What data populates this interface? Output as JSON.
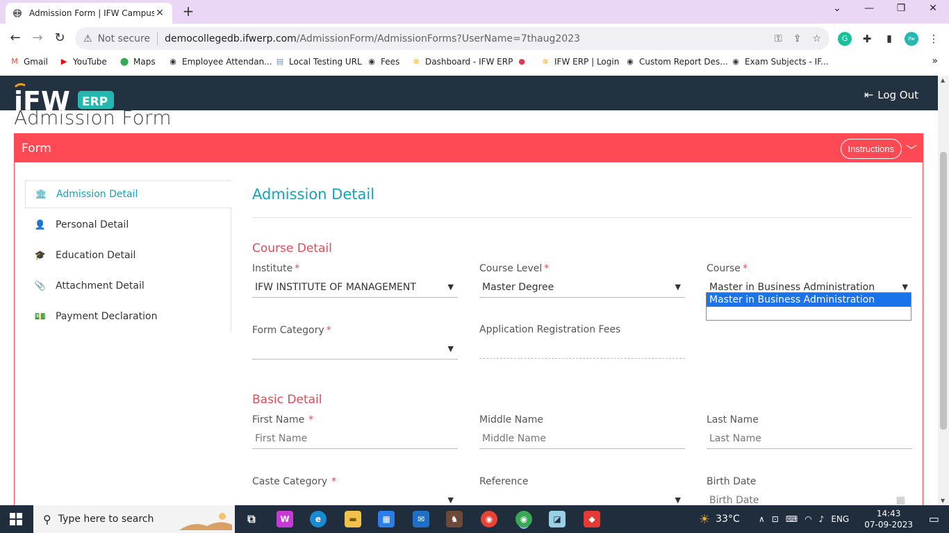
{
  "browser": {
    "tab_title": "Admission Form | IFW Campus",
    "not_secure": "Not secure",
    "url_host": "democollegedb.ifwerp.com",
    "url_path": "/AdmissionForm/AdmissionForms?UserName=7thaug2023"
  },
  "bookmarks": [
    {
      "label": "Gmail",
      "icon": "M",
      "color": "#ea4335"
    },
    {
      "label": "YouTube",
      "icon": "▶",
      "color": "#ff0000"
    },
    {
      "label": "Maps",
      "icon": "⬤",
      "color": "#34a853"
    },
    {
      "label": "Employee Attendan...",
      "icon": "◉",
      "color": "#333333"
    },
    {
      "label": "Local Testing URL",
      "icon": "▤",
      "color": "#6b8fb5"
    },
    {
      "label": "Fees",
      "icon": "◉",
      "color": "#333333"
    },
    {
      "label": "Dashboard - IFW ERP",
      "icon": "≋",
      "color": "#f0a020"
    },
    {
      "label": "",
      "icon": "●",
      "color": "#e53950"
    },
    {
      "label": "IFW ERP | Login",
      "icon": "≋",
      "color": "#f0a020"
    },
    {
      "label": "Custom Report Des...",
      "icon": "◉",
      "color": "#333333"
    },
    {
      "label": "Exam Subjects - IF...",
      "icon": "◉",
      "color": "#333333"
    }
  ],
  "header": {
    "logo_text": "iFW",
    "logo_badge": "ERP",
    "logout": "Log Out"
  },
  "page_title": "Admission Form",
  "form": {
    "bar_title": "Form",
    "instructions": "Instructions"
  },
  "sidenav": [
    {
      "label": "Admission Detail",
      "icon": "🏛",
      "name": "admission-detail"
    },
    {
      "label": "Personal Detail",
      "icon": "👤",
      "name": "personal-detail"
    },
    {
      "label": "Education Detail",
      "icon": "🎓",
      "name": "education-detail"
    },
    {
      "label": "Attachment Detail",
      "icon": "📎",
      "name": "attachment-detail"
    },
    {
      "label": "Payment Declaration",
      "icon": "💵",
      "name": "payment-declaration"
    }
  ],
  "section_title": "Admission Detail",
  "course_detail": {
    "title": "Course Detail",
    "institute_label": "Institute",
    "institute_value": "IFW INSTITUTE OF MANAGEMENT",
    "course_level_label": "Course Level",
    "course_level_value": "Master Degree",
    "course_label": "Course",
    "course_value": "Master in Business Administration",
    "form_category_label": "Form Category",
    "form_category_value": "",
    "app_fees_label": "Application Registration Fees",
    "app_fees_value": ""
  },
  "course_dropdown": {
    "options": [
      "Master in Business Administration",
      ""
    ]
  },
  "basic_detail": {
    "title": "Basic Detail",
    "first_name_label": "First Name",
    "first_name_placeholder": "First Name",
    "middle_name_label": "Middle Name",
    "middle_name_placeholder": "Middle Name",
    "last_name_label": "Last Name",
    "last_name_placeholder": "Last Name",
    "caste_label": "Caste Category",
    "reference_label": "Reference",
    "birth_date_label": "Birth Date",
    "birth_date_placeholder": "Birth Date"
  },
  "required_mark": "*",
  "taskbar": {
    "search_placeholder": "Type here to search",
    "temperature": "33°C",
    "language": "ENG",
    "time": "14:43",
    "date": "07-09-2023"
  },
  "colors": {
    "accent_red": "#ff4a55",
    "accent_teal": "#17a2b8",
    "header_dark": "#233240",
    "logo_teal": "#25b8b0"
  }
}
